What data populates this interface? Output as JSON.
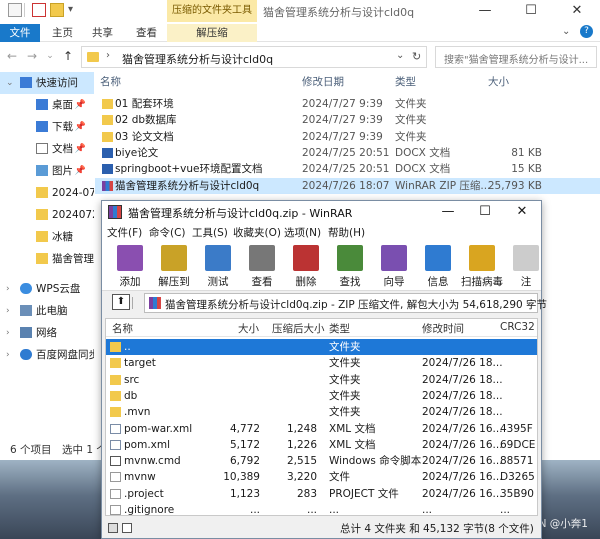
{
  "explorer": {
    "title": "猫舍管理系统分析与设计cld0q",
    "context_tab": "压缩的文件夹工具",
    "ribbon_tabs": [
      "文件",
      "主页",
      "共享",
      "查看",
      "解压缩"
    ],
    "address": "猫舍管理系统分析与设计cld0q",
    "search_placeholder": "搜索\"猫舍管理系统分析与设计...",
    "nav": [
      {
        "label": "快速访问",
        "icon": "star-icon"
      },
      {
        "label": "桌面",
        "icon": "desktop-icon",
        "pinned": true
      },
      {
        "label": "下载",
        "icon": "download-icon",
        "pinned": true
      },
      {
        "label": "文档",
        "icon": "document-icon",
        "pinned": true
      },
      {
        "label": "图片",
        "icon": "picture-icon",
        "pinned": true
      },
      {
        "label": "2024-07",
        "icon": "folder-icon"
      },
      {
        "label": "20240726",
        "icon": "folder-icon"
      },
      {
        "label": "冰糖",
        "icon": "folder-icon"
      },
      {
        "label": "猫舍管理系",
        "icon": "folder-icon"
      },
      {
        "label": "WPS云盘",
        "icon": "cloud-icon"
      },
      {
        "label": "此电脑",
        "icon": "computer-icon"
      },
      {
        "label": "网络",
        "icon": "network-icon"
      },
      {
        "label": "百度网盘同步",
        "icon": "baidu-icon"
      }
    ],
    "columns": [
      "名称",
      "修改日期",
      "类型",
      "大小"
    ],
    "files": [
      {
        "name": "01 配套环境",
        "date": "2024/7/27 9:39",
        "type": "文件夹",
        "size": "",
        "icon": "folder-icon"
      },
      {
        "name": "02 db数据库",
        "date": "2024/7/27 9:39",
        "type": "文件夹",
        "size": "",
        "icon": "folder-icon"
      },
      {
        "name": "03 论文文档",
        "date": "2024/7/27 9:39",
        "type": "文件夹",
        "size": "",
        "icon": "folder-icon"
      },
      {
        "name": "biye论文",
        "date": "2024/7/25 20:51",
        "type": "DOCX 文档",
        "size": "81 KB",
        "icon": "word-icon"
      },
      {
        "name": "springboot+vue环境配置文档",
        "date": "2024/7/25 20:51",
        "type": "DOCX 文档",
        "size": "15 KB",
        "icon": "word-icon"
      },
      {
        "name": "猫舍管理系统分析与设计cld0q",
        "date": "2024/7/26 18:07",
        "type": "WinRAR ZIP 压缩...",
        "size": "25,793 KB",
        "icon": "winrar-icon",
        "selected": true
      }
    ],
    "status": [
      "6 个项目",
      "选中 1 个"
    ]
  },
  "winrar": {
    "title": "猫舍管理系统分析与设计cld0q.zip - WinRAR",
    "menu": [
      "文件(F)",
      "命令(C)",
      "工具(S)",
      "收藏夹(O)",
      "选项(N)",
      "帮助(H)"
    ],
    "toolbar": [
      {
        "label": "添加",
        "icon": "add-archive-icon",
        "color": "#8a4fb0"
      },
      {
        "label": "解压到",
        "icon": "extract-to-icon",
        "color": "#c9a227"
      },
      {
        "label": "测试",
        "icon": "test-icon",
        "color": "#3b7bc8"
      },
      {
        "label": "查看",
        "icon": "view-icon",
        "color": "#777777"
      },
      {
        "label": "删除",
        "icon": "delete-icon",
        "color": "#b33"
      },
      {
        "label": "查找",
        "icon": "find-icon",
        "color": "#4a8a3a"
      },
      {
        "label": "向导",
        "icon": "wizard-icon",
        "color": "#7a4fb0"
      },
      {
        "label": "信息",
        "icon": "info-icon",
        "color": "#2f7bd1"
      },
      {
        "label": "扫描病毒",
        "icon": "scan-virus-icon",
        "color": "#d9a520"
      },
      {
        "label": "注",
        "icon": "comment-icon",
        "color": "#cccccc"
      }
    ],
    "path": "猫舍管理系统分析与设计cld0q.zip - ZIP 压缩文件, 解包大小为 54,618,290 字节",
    "columns": [
      "名称",
      "大小",
      "压缩后大小",
      "类型",
      "修改时间",
      "CRC32"
    ],
    "rows": [
      {
        "name": "..",
        "size": "",
        "packed": "",
        "type": "文件夹",
        "modified": "",
        "crc": "",
        "icon": "folder-icon",
        "selected": true
      },
      {
        "name": "target",
        "size": "",
        "packed": "",
        "type": "文件夹",
        "modified": "2024/7/26 18...",
        "crc": "",
        "icon": "folder-icon"
      },
      {
        "name": "src",
        "size": "",
        "packed": "",
        "type": "文件夹",
        "modified": "2024/7/26 18...",
        "crc": "",
        "icon": "folder-icon"
      },
      {
        "name": "db",
        "size": "",
        "packed": "",
        "type": "文件夹",
        "modified": "2024/7/26 18...",
        "crc": "",
        "icon": "folder-icon"
      },
      {
        "name": ".mvn",
        "size": "",
        "packed": "",
        "type": "文件夹",
        "modified": "2024/7/26 18...",
        "crc": "",
        "icon": "folder-icon"
      },
      {
        "name": "pom-war.xml",
        "size": "4,772",
        "packed": "1,248",
        "type": "XML 文档",
        "modified": "2024/7/26 16...",
        "crc": "4395F",
        "icon": "xml-icon"
      },
      {
        "name": "pom.xml",
        "size": "5,172",
        "packed": "1,226",
        "type": "XML 文档",
        "modified": "2024/7/26 16...",
        "crc": "69DCE",
        "icon": "xml-icon"
      },
      {
        "name": "mvnw.cmd",
        "size": "6,792",
        "packed": "2,515",
        "type": "Windows 命令脚本",
        "modified": "2024/7/26 16...",
        "crc": "88571",
        "icon": "cmd-icon"
      },
      {
        "name": "mvnw",
        "size": "10,389",
        "packed": "3,220",
        "type": "文件",
        "modified": "2024/7/26 16...",
        "crc": "D3265",
        "icon": "file-icon"
      },
      {
        "name": ".project",
        "size": "1,123",
        "packed": "283",
        "type": "PROJECT 文件",
        "modified": "2024/7/26 16...",
        "crc": "35B90",
        "icon": "file-icon"
      },
      {
        "name": ".gitignore",
        "size": "...",
        "packed": "...",
        "type": "...",
        "modified": "...",
        "crc": "...",
        "icon": "file-icon"
      }
    ],
    "status": "总计 4 文件夹 和 45,132 字节(8 个文件)"
  },
  "watermark": "CSDN @小奔1"
}
